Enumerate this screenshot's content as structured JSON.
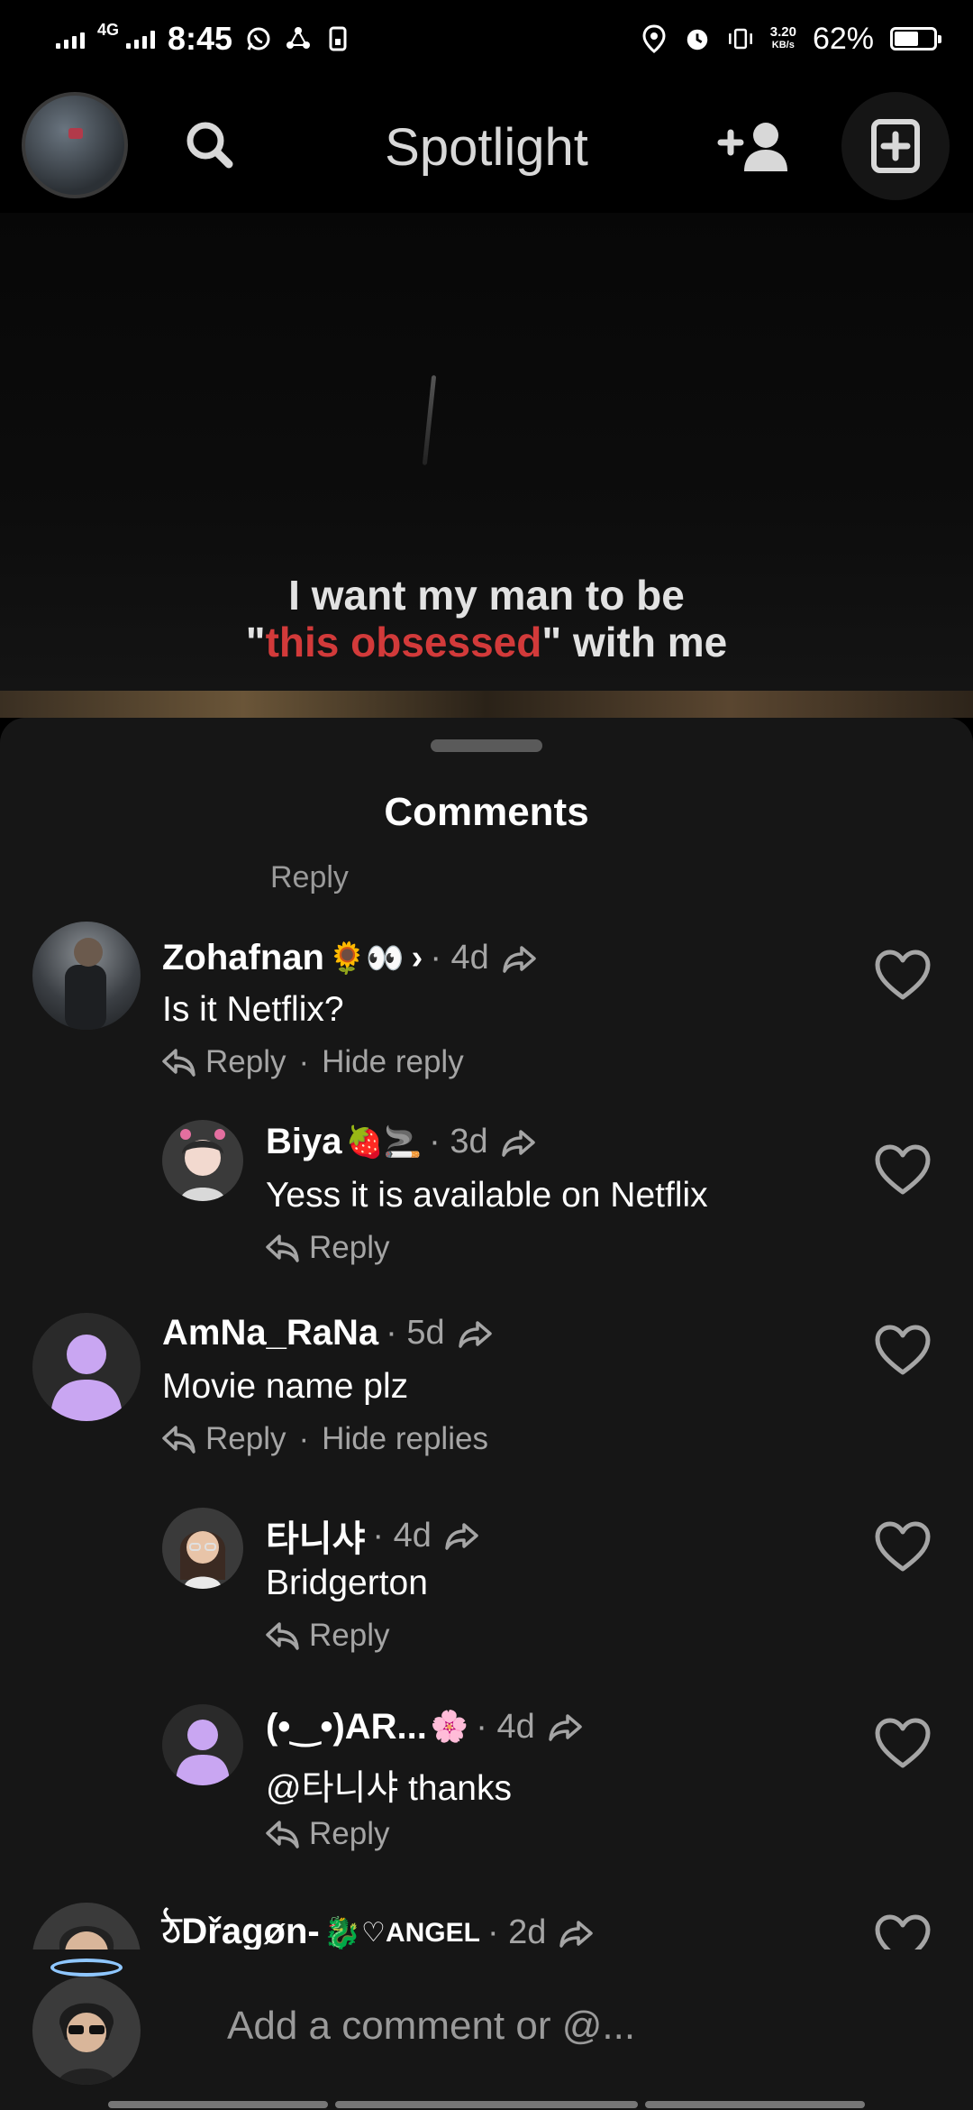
{
  "status_bar": {
    "network": "4G",
    "time": "8:45",
    "speed_value": "3.20",
    "speed_unit": "KB/s",
    "battery_percent": "62%",
    "battery_level": 0.62
  },
  "top_nav": {
    "title": "Spotlight"
  },
  "video": {
    "caption_line1": "I want my man to be",
    "caption_quote_open": "\"",
    "caption_highlight": "this obsessed",
    "caption_quote_close": "\" with me",
    "highlight_color": "#d23a3a"
  },
  "comments_sheet": {
    "title": "Comments",
    "cut_off_reply": "Reply",
    "comments": [
      {
        "name": "Zohafnan",
        "emoji": "🌻👀",
        "chevron": "›",
        "meta": "· 4d",
        "text": "Is it Netflix?",
        "reply_label": "Reply",
        "hide_label": "Hide reply"
      },
      {
        "name": "Biya",
        "emoji": "🍓🚬",
        "meta": "· 3d",
        "text": "Yess it is available on Netflix",
        "reply_label": "Reply"
      },
      {
        "name": "AmNa_RaNa",
        "meta": "· 5d",
        "text": "Movie name plz",
        "reply_label": "Reply",
        "hide_label": "Hide replies"
      },
      {
        "name": "타니샤",
        "meta": "· 4d",
        "text": "Bridgerton",
        "reply_label": "Reply"
      },
      {
        "name": "(•‿•)AR...",
        "emoji": "🌸",
        "meta": "· 4d",
        "text": "@타니샤 thanks",
        "reply_label": "Reply"
      },
      {
        "name": "ঠDřagøn-",
        "emoji": "🐉",
        "name_suffix": "♡ANGEL",
        "meta": "· 2d"
      }
    ]
  },
  "composer": {
    "placeholder": "Add a comment or @..."
  }
}
